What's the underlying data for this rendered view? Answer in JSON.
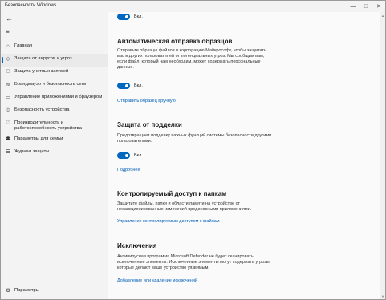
{
  "titlebar": {
    "title": "Безопасность Windows",
    "minimize": "—",
    "maximize": "□",
    "close": "✕"
  },
  "sidebar": {
    "back": "←",
    "menu": "≡",
    "items": [
      {
        "label": "Главная",
        "icon": "home-icon",
        "glyph": "⌂"
      },
      {
        "label": "Защита от вирусов и угроз",
        "icon": "shield-icon",
        "glyph": "◇"
      },
      {
        "label": "Защита учетных записей",
        "icon": "person-icon",
        "glyph": "⚇"
      },
      {
        "label": "Брандмауэр и безопасность сети",
        "icon": "wifi-icon",
        "glyph": "≋"
      },
      {
        "label": "Управление приложениями и браузером",
        "icon": "app-window-icon",
        "glyph": "▭"
      },
      {
        "label": "Безопасность устройства",
        "icon": "device-icon",
        "glyph": "▯"
      },
      {
        "label": "Производительность и работоспособность устройства",
        "icon": "heart-icon",
        "glyph": "♡"
      },
      {
        "label": "Параметры для семьи",
        "icon": "family-icon",
        "glyph": "⚉"
      },
      {
        "label": "Журнал защиты",
        "icon": "history-icon",
        "glyph": "☰"
      }
    ],
    "settings": {
      "label": "Параметры",
      "icon": "gear-icon",
      "glyph": "⚙"
    }
  },
  "main": {
    "toggle_top": {
      "label": "Вкл."
    },
    "sample": {
      "title": "Автоматическая отправка образцов",
      "desc": "Отправьте образцы файлов в корпорацию Майкрософт, чтобы защитить вас и других пользователей от потенциальных угроз. Мы сообщим вам, если файл, который нам необходим, может содержать персональные данные.",
      "toggle_label": "Вкл.",
      "link": "Отправить образец вручную"
    },
    "tamper": {
      "title": "Защита от подделки",
      "desc": "Предотвращает подделку важных функций системы безопасности другими пользователями.",
      "toggle_label": "Вкл.",
      "link": "Подробнее"
    },
    "cfa": {
      "title": "Контролируемый доступ к папкам",
      "desc": "Защитите файлы, папки и области памяти на устройстве от несанкционированных изменений вредоносными приложениями.",
      "link": "Управление контролируемым доступом к файлам"
    },
    "exclusions": {
      "title": "Исключения",
      "desc": "Антивирусная программа Microsoft Defender не будет сканировать исключенные элементы. Исключенные элементы могут содержать угрозы, которые делают ваше устройство уязвимым.",
      "link": "Добавление или удаление исключений"
    }
  }
}
